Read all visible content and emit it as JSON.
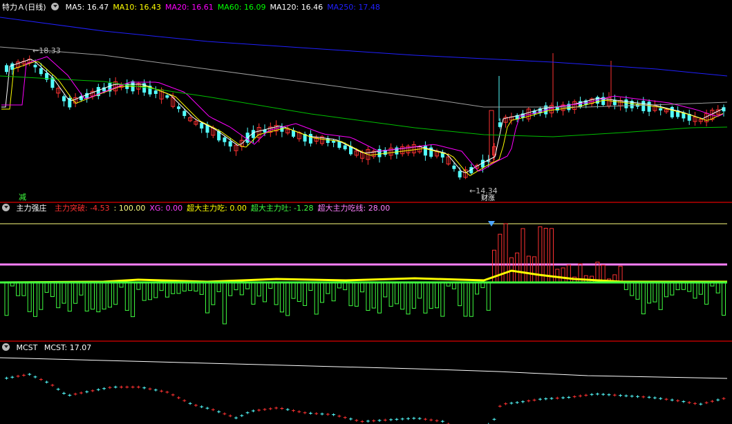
{
  "main": {
    "title": "特力Ａ(日线)",
    "ma": [
      {
        "label": "MA5: ",
        "value": "16.47",
        "color": "#ffffff"
      },
      {
        "label": "MA10: ",
        "value": "16.43",
        "color": "#ffff00"
      },
      {
        "label": "MA20: ",
        "value": "16.61",
        "color": "#ff00ff"
      },
      {
        "label": "MA60: ",
        "value": "16.09",
        "color": "#00ff00"
      },
      {
        "label": "MA120: ",
        "value": "16.46",
        "color": "#ffffff"
      },
      {
        "label": "MA250: ",
        "value": "17.48",
        "color": "#2020ff"
      }
    ],
    "high_label": "18.33",
    "low_label": "14.34",
    "reduce_tag": "减",
    "buy_tag": "财涨"
  },
  "indicator": {
    "title": "主力强庄",
    "items": [
      {
        "label": "主力突破: ",
        "value": "-4.53",
        "color": "#ff3030"
      },
      {
        "label": ": ",
        "value": "100.00",
        "color": "#ffff80"
      },
      {
        "label": "XG: ",
        "value": "0.00",
        "color": "#ff40ff"
      },
      {
        "label": "超大主力吃: ",
        "value": "0.00",
        "color": "#ffff00"
      },
      {
        "label": "超大主力吐: ",
        "value": "-1.28",
        "color": "#40ff40"
      },
      {
        "label": "超大主力吃线: ",
        "value": "28.00",
        "color": "#ff80ff"
      }
    ]
  },
  "mcst": {
    "title": "MCST",
    "label": "MCST: ",
    "value": "17.07"
  },
  "colors": {
    "up": "#ff3232",
    "down": "#54ffff",
    "ma5": "#ffffff",
    "ma10": "#ffff00",
    "ma20": "#ff00ff",
    "ma60": "#00c000",
    "ma120": "#a0a0a0",
    "ma250": "#2020ff",
    "divider": "#8b0000"
  }
}
